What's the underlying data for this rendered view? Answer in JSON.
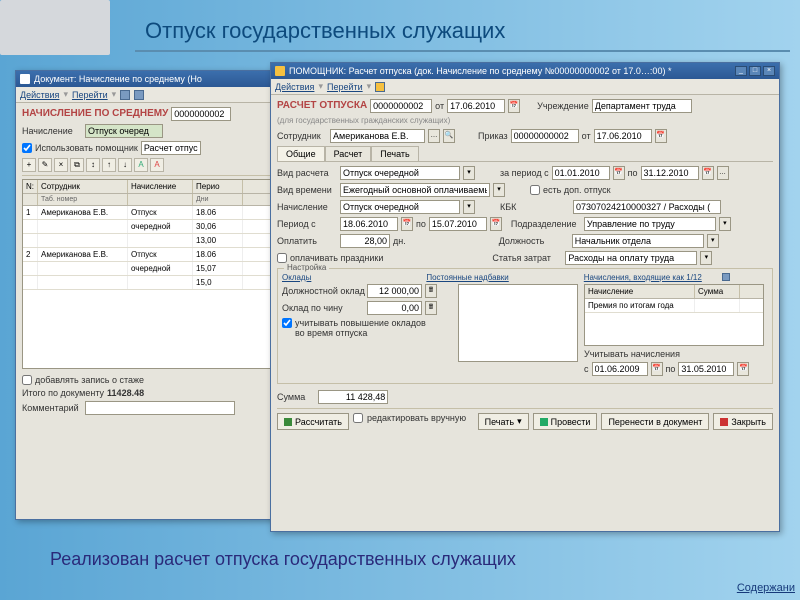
{
  "page": {
    "title": "Отпуск государственных служащих",
    "footer": "Реализован расчет отпуска государственных служащих",
    "toc": "Содержани"
  },
  "win1": {
    "title": "Документ: Начисление по среднему (Но",
    "menu_actions": "Действия",
    "menu_go": "Перейти",
    "section": "НАЧИСЛЕНИЕ ПО СРЕДНЕМУ",
    "doc_no": "0000000002",
    "lbl_accrual": "Начисление",
    "val_accrual": "Отпуск очеред",
    "chk_helper": "Использовать помощник",
    "helper_val": "Расчет отпус",
    "grid": {
      "cols": [
        "N:",
        "Сотрудник",
        "Начисление",
        "Перио"
      ],
      "sub": [
        "",
        "Таб. номер",
        "",
        "Дни"
      ],
      "rows": [
        {
          "n": "1",
          "emp": "Американова Е.В.",
          "acc": "Отпуск",
          "date1": "18.06",
          "sub2": "очередной",
          "date2": "30,06",
          "val": "13,00"
        },
        {
          "n": "2",
          "emp": "Американова Е.В.",
          "acc": "Отпуск",
          "date1": "18.06",
          "sub2": "очередной",
          "date2": "15,07",
          "val": "15,0"
        }
      ]
    },
    "chk_stage": "добавлять запись о стаже",
    "lbl_total": "Итого по документу",
    "val_total": "11428.48",
    "lbl_comment": "Комментарий"
  },
  "win2": {
    "title": "ПОМОЩНИК: Расчет отпуска (док. Начисление по среднему №00000000002 от 17.0…:00) *",
    "menu_actions": "Действия",
    "menu_go": "Перейти",
    "section": "РАСЧЕТ ОТПУСКА",
    "section_sub": "(для государственных гражданских служащих)",
    "doc_no": "0000000002",
    "lbl_from": "от",
    "date1": "17.06.2010",
    "lbl_org": "Учреждение",
    "org": "Департамент труда",
    "lbl_emp": "Сотрудник",
    "emp": "Американова Е.В.",
    "lbl_order": "Приказ",
    "order": "00000000002",
    "order_date": "17.06.2010",
    "tabs": [
      "Общие",
      "Расчет",
      "Печать"
    ],
    "lbl_calc_type": "Вид расчета",
    "calc_type": "Отпуск очередной",
    "lbl_period": "за период с",
    "period_from": "01.01.2010",
    "period_to": "31.12.2010",
    "lbl_time_type": "Вид времени",
    "time_type": "Ежегодный основной оплачиваемь",
    "chk_extra": "есть доп. отпуск",
    "lbl_accrual2": "Начисление",
    "accrual2": "Отпуск очередной",
    "lbl_kbk": "КБК",
    "kbk": "07307024210000327 / Расходы (",
    "lbl_period2": "Период с",
    "period2_from": "18.06.2010",
    "period2_to": "15.07.2010",
    "lbl_dept": "Подразделение",
    "dept": "Управление по труду",
    "lbl_pay": "Оплатить",
    "pay_days": "28,00",
    "lbl_days": "дн.",
    "lbl_pos": "Должность",
    "pos": "Начальник отдела",
    "chk_holidays": "оплачивать праздники",
    "lbl_expense": "Статья затрат",
    "expense": "Расходы на оплату труда",
    "group_settings": "Настройка",
    "col_salary": "Оклады",
    "col_allow": "Постоянные надбавки",
    "col_accr": "Начисления, входящие как 1/12",
    "lbl_base_salary": "Должностной оклад",
    "base_salary": "12 000,00",
    "lbl_rank_salary": "Оклад по чину",
    "rank_salary": "0,00",
    "chk_raise": "учитывать повышение окладов во время отпуска",
    "grid2_h1": "Начисление",
    "grid2_h2": "Сумма",
    "grid2_row": "Премия по итогам года",
    "lbl_consider": "Учитывать начисления",
    "lbl_c": "с",
    "consider_from": "01.06.2009",
    "consider_to": "31.05.2010",
    "lbl_sum": "Сумма",
    "sum": "11 428,48",
    "btn_calc": "Рассчитать",
    "chk_manual": "редактировать вручную",
    "btn_print": "Печать",
    "btn_run": "Провести",
    "btn_transfer": "Перенести в документ",
    "btn_close": "Закрыть",
    "lbl_po": "по"
  }
}
